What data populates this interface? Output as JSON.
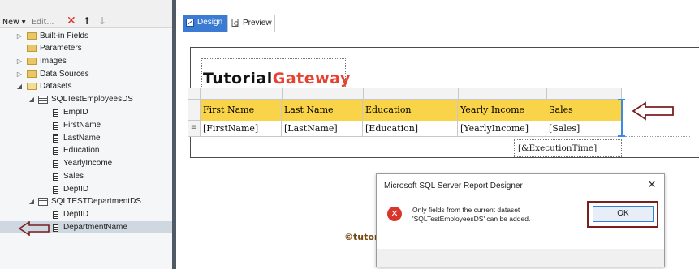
{
  "toolbar": {
    "new_label": "New ▾",
    "edit_label": "Edit...",
    "delete_icon": "✕",
    "up_icon": "↑",
    "down_icon": "↓"
  },
  "tree": {
    "items": [
      {
        "label": "Built-in Fields",
        "expander": "▷",
        "icon": "folder-icon"
      },
      {
        "label": "Parameters",
        "expander": "",
        "icon": "folder-icon"
      },
      {
        "label": "Images",
        "expander": "▷",
        "icon": "folder-icon"
      },
      {
        "label": "Data Sources",
        "expander": "▷",
        "icon": "folder-icon"
      },
      {
        "label": "Datasets",
        "expander": "◢",
        "icon": "folder-open-icon"
      },
      {
        "label": "SQLTestEmployeesDS",
        "expander": "◢",
        "icon": "dataset-icon"
      },
      {
        "label": "EmpID",
        "icon": "field-icon"
      },
      {
        "label": "FirstName",
        "icon": "field-icon"
      },
      {
        "label": "LastName",
        "icon": "field-icon"
      },
      {
        "label": "Education",
        "icon": "field-icon"
      },
      {
        "label": "YearlyIncome",
        "icon": "field-icon"
      },
      {
        "label": "Sales",
        "icon": "field-icon"
      },
      {
        "label": "DeptID",
        "icon": "field-icon"
      },
      {
        "label": "SQLTESTDepartmentDS",
        "expander": "◢",
        "icon": "dataset-icon"
      },
      {
        "label": "DeptID",
        "icon": "field-icon"
      },
      {
        "label": "DepartmentName",
        "icon": "field-icon",
        "selected": true
      }
    ]
  },
  "tabs": {
    "design": "Design",
    "preview": "Preview"
  },
  "report": {
    "logo_part1": "Tutorial",
    "logo_part2": "Gateway",
    "headers": [
      "First Name",
      "Last Name",
      "Education",
      "Yearly Income",
      "Sales"
    ],
    "row": [
      "[FirstName]",
      "[LastName]",
      "[Education]",
      "[YearlyIncome]",
      "[Sales]"
    ],
    "row_handle": "≡",
    "execution_time": "[&ExecutionTime]",
    "header_color": "#f9d348"
  },
  "watermark": "©tutorialgateway.org",
  "dialog": {
    "title": "Microsoft SQL Server Report Designer",
    "close": "✕",
    "error_glyph": "✕",
    "message_line1": "Only fields from the current dataset",
    "message_line2": "'SQLTestEmployeesDS' can be added.",
    "ok_label": "OK"
  },
  "colors": {
    "accent": "#3b7bd4",
    "annotation": "#7a1f1f",
    "logo_red": "#e8412f"
  }
}
